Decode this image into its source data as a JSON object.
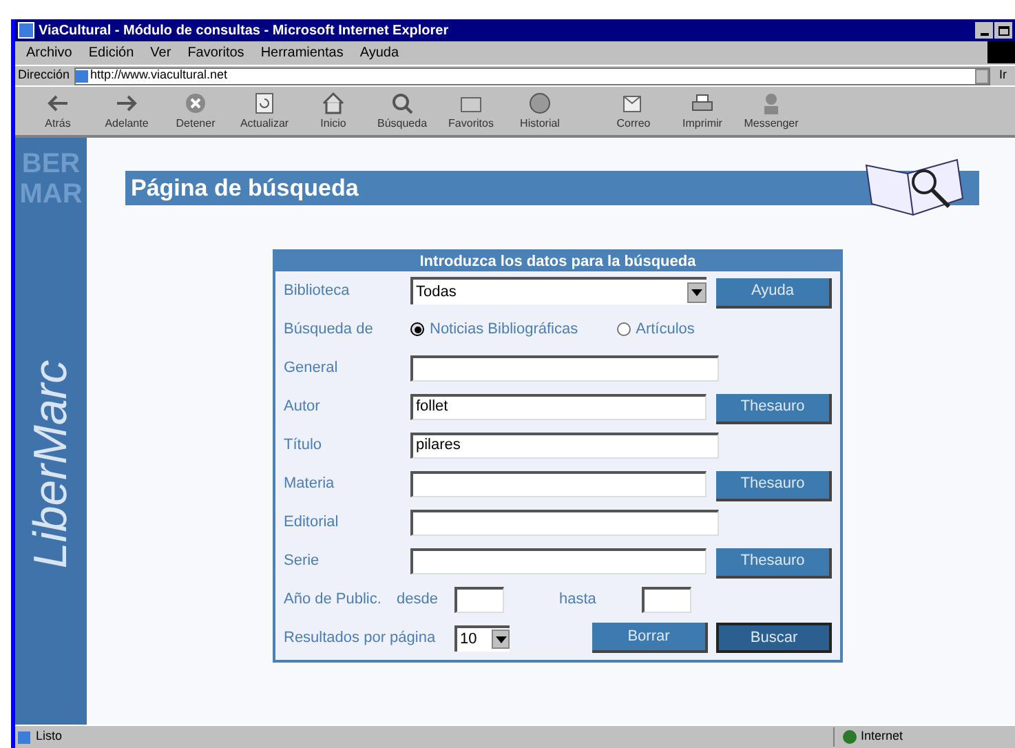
{
  "window": {
    "title": "ViaCultural - Módulo de consultas - Microsoft Internet Explorer"
  },
  "menu": [
    "Archivo",
    "Edición",
    "Ver",
    "Favoritos",
    "Herramientas",
    "Ayuda"
  ],
  "address": {
    "label": "Dirección",
    "value": "http://www.viacultural.net",
    "go": "Ir"
  },
  "toolbar": [
    {
      "label": "Atrás",
      "kind": "back"
    },
    {
      "label": "Adelante",
      "kind": "forward"
    },
    {
      "label": "Detener",
      "kind": "stop"
    },
    {
      "label": "Actualizar",
      "kind": "refresh"
    },
    {
      "label": "Inicio",
      "kind": "home"
    },
    {
      "label": "Búsqueda",
      "kind": "search"
    },
    {
      "label": "Favoritos",
      "kind": "favorites"
    },
    {
      "label": "Historial",
      "kind": "history"
    },
    {
      "label": "Correo",
      "kind": "mail"
    },
    {
      "label": "Imprimir",
      "kind": "print"
    },
    {
      "label": "Messenger",
      "kind": "messenger"
    }
  ],
  "sidebar": {
    "logo_lines": [
      "BER",
      "MAR"
    ],
    "brand": "LiberMarc"
  },
  "page_title": "Página de búsqueda",
  "form": {
    "header": "Introduzca los datos para la búsqueda",
    "rows": [
      {
        "kind": "select",
        "label": "Biblioteca",
        "value": "Todas",
        "button": "Ayuda"
      },
      {
        "kind": "radio",
        "label": "Búsqueda de",
        "options": [
          {
            "label": "Noticias Bibliográficas",
            "selected": true
          },
          {
            "label": "Artículos",
            "selected": false
          }
        ]
      },
      {
        "kind": "text",
        "label": "General"
      },
      {
        "kind": "text",
        "label": "Autor",
        "value": "follet",
        "button": "Thesauro"
      },
      {
        "kind": "text",
        "label": "Título",
        "value": "pilares"
      },
      {
        "kind": "text",
        "label": "Materia",
        "button": "Thesauro"
      },
      {
        "kind": "text",
        "label": "Editorial"
      },
      {
        "kind": "text",
        "label": "Serie",
        "button": "Thesauro"
      },
      {
        "kind": "years",
        "label": "Año de Public.",
        "from": "desde",
        "to": "hasta"
      },
      {
        "kind": "results",
        "label": "Resultados por página",
        "value": "10",
        "buttons": [
          "Borrar",
          "Buscar"
        ]
      }
    ]
  },
  "status_bar": {
    "text": "Listo",
    "zone": "Internet"
  }
}
